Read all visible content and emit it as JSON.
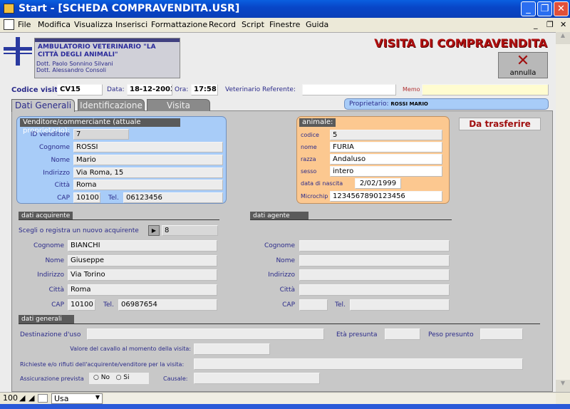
{
  "window": {
    "title": "Start - [SCHEDA COMPRAVENDITA.USR]"
  },
  "menu": [
    "File",
    "Modifica",
    "Visualizza",
    "Inserisci",
    "Formattazione",
    "Record",
    "Script",
    "Finestre",
    "Guida"
  ],
  "header": {
    "clinic": "AMBULATORIO VETERINARIO \"LA CITTÀ DEGLI ANIMALI\"",
    "doctor1": "Dott. Paolo Sonnino Silvani",
    "doctor2": "Dott. Alessandro Consoli",
    "title": "VISITA DI COMPRAVENDITA",
    "cancel_label": "annulla"
  },
  "visit": {
    "code_label": "Codice visita",
    "code": "CV15",
    "date_label": "Data:",
    "date": "18-12-2003",
    "time_label": "Ora:",
    "time": "17:58",
    "vet_label": "Veterinario Referente:",
    "vet": "",
    "memo_label": "Memo",
    "memo": ""
  },
  "tabs": [
    "Dati Generali",
    "Identificazione",
    "Visita"
  ],
  "owner": {
    "label": "Proprietario:",
    "value": "ROSSI MARIO"
  },
  "seller": {
    "title": "Venditore/commerciante (attuale proprietario):",
    "id_label": "ID venditore",
    "id": "7",
    "surname_label": "Cognome",
    "surname": "ROSSI",
    "name_label": "Nome",
    "name": "Mario",
    "address_label": "Indirizzo",
    "address": "Via Roma, 15",
    "city_label": "Città",
    "city": "Roma",
    "cap_label": "CAP",
    "cap": "10100",
    "tel_label": "Tel.",
    "tel": "06123456"
  },
  "animal": {
    "title": "animale:",
    "code_label": "codice",
    "code": "5",
    "name_label": "nome",
    "name": "FURIA",
    "breed_label": "razza",
    "breed": "Andaluso",
    "sex_label": "sesso",
    "sex": "intero",
    "birth_label": "data di nascita",
    "birth": "2/02/1999",
    "chip_label": "Microchip",
    "chip": "1234567890123456"
  },
  "status": "Da trasferire",
  "buyer": {
    "title": "dati acquirente",
    "choose_label": "Scegli o registra un nuovo acquirente",
    "id": "8",
    "surname_label": "Cognome",
    "surname": "BIANCHI",
    "name_label": "Nome",
    "name": "Giuseppe",
    "address_label": "Indirizzo",
    "address": "Via Torino",
    "city_label": "Città",
    "city": "Roma",
    "cap_label": "CAP",
    "cap": "10100",
    "tel_label": "Tel.",
    "tel": "06987654"
  },
  "agent": {
    "title": "dati agente",
    "surname_label": "Cognome",
    "name_label": "Nome",
    "address_label": "Indirizzo",
    "city_label": "Città",
    "cap_label": "CAP",
    "tel_label": "Tel."
  },
  "general": {
    "title": "dati generali",
    "use_label": "Destinazione d'uso",
    "age_label": "Età presunta",
    "weight_label": "Peso presunto",
    "value_label": "Valore del cavallo al momento della visita:",
    "requests_label": "Richieste e/o rifiuti dell'acquirente/venditore per la visita:",
    "insurance_label": "Assicurazione prevista",
    "no_label": "No",
    "yes_label": "Si",
    "reason_label": "Causale:"
  },
  "statusbar": {
    "zoom": "100",
    "mode": "Usa"
  }
}
